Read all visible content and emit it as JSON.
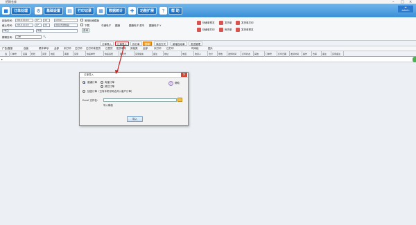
{
  "window": {
    "title": "招财仓库",
    "minimize": "–",
    "maximize": "□",
    "close": "×"
  },
  "ribbon": {
    "tabs": [
      {
        "label": "订单处理",
        "icon": "orders-icon"
      },
      {
        "label": "基础设置",
        "icon": "settings-icon"
      },
      {
        "label": "打印记录",
        "icon": "print-icon"
      },
      {
        "label": "数据统计",
        "icon": "stats-icon"
      },
      {
        "label": "功能扩展",
        "icon": "extend-icon"
      },
      {
        "label": "帮    助",
        "icon": "help-icon"
      }
    ],
    "user": "admin"
  },
  "filters": {
    "start_label": "起始时间:",
    "start_date": "2019-10-16",
    "start_hour": "07",
    "start_min": "40",
    "end_label": "截止时间:",
    "end_date": "2019-10-18",
    "end_hour": "07",
    "end_min": "39",
    "type_value": "[电汇]",
    "type2_value": "快递",
    "buyer_value": "admin",
    "status_value": "到货(普通快递)",
    "remark_label": "常用检索模板",
    "download_label": "下载",
    "checks": [
      "中通电子",
      "圆通",
      "圆通电子-菜鸟",
      "圆通电子-Y"
    ],
    "search_btn": "查询"
  },
  "actions": {
    "express_print": "快递单预览",
    "express_print2": "快递单打印",
    "sender": "发货单",
    "sender_print": "发货单打印",
    "pick": "拣货单",
    "pick_print": "发货单预览"
  },
  "search": {
    "label": "模糊查询:",
    "value": "订单",
    "go": "🔍"
  },
  "toolbar": {
    "items": [
      "订单导入",
      "订单导入",
      "拆分单",
      "删单",
      "商品方式",
      "新增自动单",
      "发送管理"
    ],
    "highlight_index": 1
  },
  "toolbar3": {
    "items": [
      "广告/直报",
      "自营",
      "顺丰单号:",
      "全部",
      "未打印",
      "已打印",
      "已打印未发货",
      "已发货",
      "配货单号",
      "其他类",
      "全部",
      "未打印",
      "已打印",
      "时间段",
      "图片"
    ]
  },
  "grid": {
    "columns": [
      "选",
      "订单号",
      "店铺",
      "旺旺",
      "买家",
      "地区",
      "客服",
      "买家",
      "快递单号",
      "快递运费",
      "旺旺号",
      "买家留言",
      "备注",
      "地址",
      "电话",
      "收货人",
      "合计",
      "件数",
      "发件时间",
      "打印状态",
      "其他",
      "订单号",
      "打印日期",
      "发货时间",
      "操作",
      "仓库",
      "备注",
      "买家备注"
    ]
  },
  "dialog": {
    "title": "订单导入",
    "help": "帮助",
    "opt_normal": "普通订单",
    "opt_custom": "淘宝订单",
    "opt_other": "其它订单",
    "opt_merge": "加密订单（已有手机号码合并入客户订单）",
    "file_label": "Excel 文件名:",
    "template": "导入模板",
    "import_btn": "导入"
  },
  "colors": {
    "accent": "#2b86d6",
    "highlight": "#d32020"
  }
}
